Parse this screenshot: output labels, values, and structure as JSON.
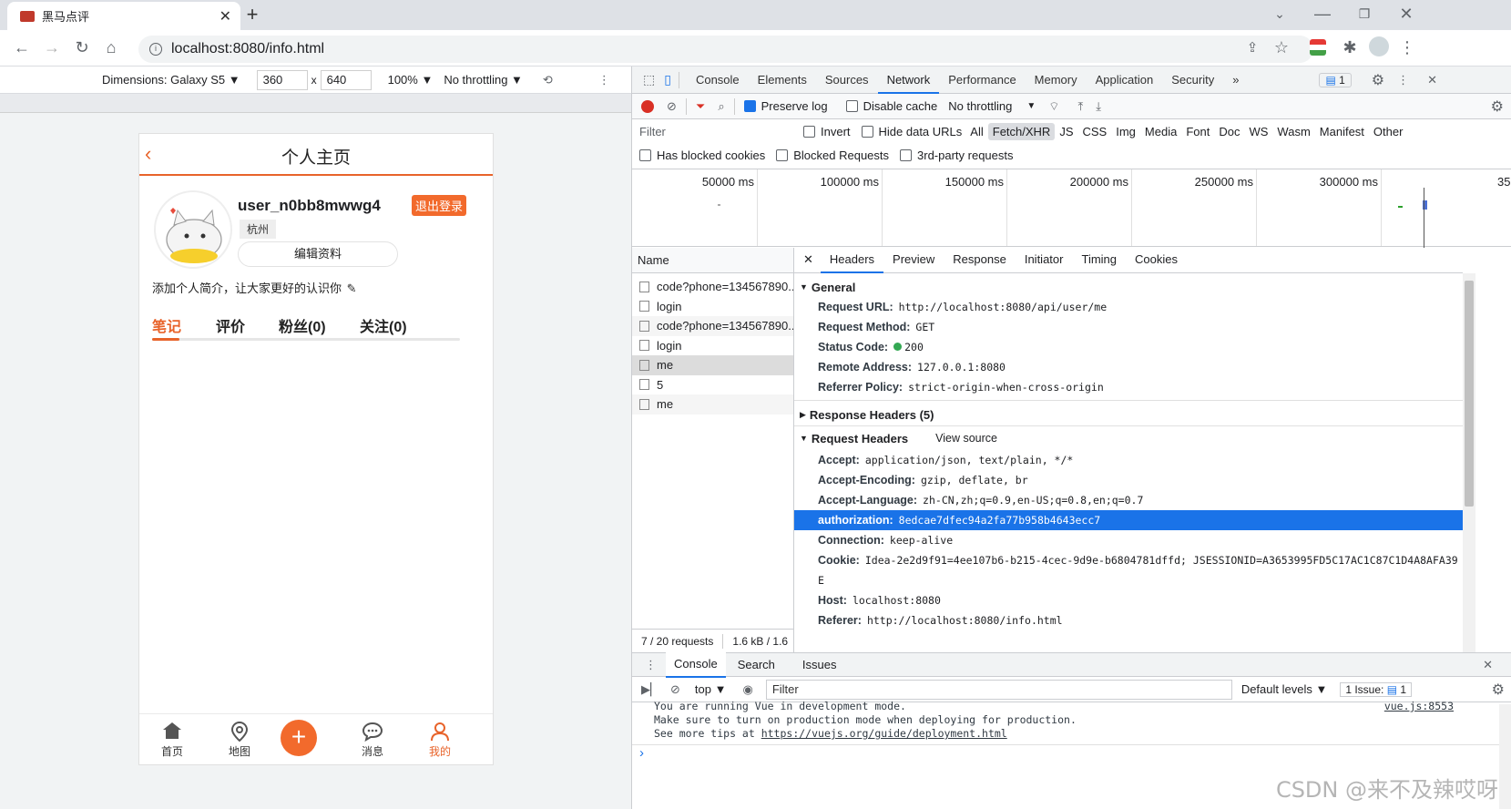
{
  "browser": {
    "tab_title": "黑马点评",
    "url": "localhost:8080/info.html"
  },
  "device_toolbar": {
    "dimensions_label": "Dimensions: Galaxy S5 ▼",
    "width": "360",
    "times": "x",
    "height": "640",
    "zoom": "100% ▼",
    "throttle": "No throttling ▼"
  },
  "page": {
    "title": "个人主页",
    "back_icon": "chevron-left-icon",
    "nickname": "user_n0bb8mwwg4",
    "logout": "退出登录",
    "city": "杭州",
    "edit_profile": "编辑资料",
    "intro": "添加个人简介，让大家更好的认识你",
    "tabs": [
      "笔记",
      "评价",
      "粉丝(0)",
      "关注(0)"
    ],
    "accent_color": "#f26a2c",
    "bottom_nav": [
      {
        "label": "首页",
        "icon": "home-icon"
      },
      {
        "label": "地图",
        "icon": "map-pin-icon"
      },
      {
        "label": "",
        "icon": "plus-icon"
      },
      {
        "label": "消息",
        "icon": "message-icon"
      },
      {
        "label": "我的",
        "icon": "user-icon"
      }
    ]
  },
  "devtools": {
    "main_tabs": [
      "Console",
      "Elements",
      "Sources",
      "Network",
      "Performance",
      "Memory",
      "Application",
      "Security",
      "»"
    ],
    "active_tab": "Network",
    "issues_badge": "1",
    "preserve_log": "Preserve log",
    "disable_cache": "Disable cache",
    "throttling": "No throttling",
    "filter_placeholder": "Filter",
    "invert": "Invert",
    "hide_data_urls": "Hide data URLs",
    "type_filters": [
      "All",
      "Fetch/XHR",
      "JS",
      "CSS",
      "Img",
      "Media",
      "Font",
      "Doc",
      "WS",
      "Wasm",
      "Manifest",
      "Other"
    ],
    "selected_type": "Fetch/XHR",
    "blocked_cookies": "Has blocked cookies",
    "blocked_requests": "Blocked Requests",
    "third_party": "3rd-party requests",
    "timeline_labels": [
      "50000 ms",
      "100000 ms",
      "150000 ms",
      "200000 ms",
      "250000 ms",
      "300000 ms",
      "35"
    ],
    "name_header": "Name",
    "requests": [
      "code?phone=134567890...",
      "login",
      "code?phone=134567890...",
      "login",
      "me",
      "5",
      "me"
    ],
    "footer_requests": "7 / 20 requests",
    "footer_size": "1.6 kB / 1.6",
    "detail_tabs": [
      "Headers",
      "Preview",
      "Response",
      "Initiator",
      "Timing",
      "Cookies"
    ],
    "general_title": "General",
    "general": [
      {
        "k": "Request URL:",
        "v": "http://localhost:8080/api/user/me"
      },
      {
        "k": "Request Method:",
        "v": "GET"
      },
      {
        "k": "Status Code:",
        "v": "200"
      },
      {
        "k": "Remote Address:",
        "v": "127.0.0.1:8080"
      },
      {
        "k": "Referrer Policy:",
        "v": "strict-origin-when-cross-origin"
      }
    ],
    "response_headers_title": "Response Headers (5)",
    "request_headers_title": "Request Headers",
    "view_source": "View source",
    "request_headers": [
      {
        "k": "Accept:",
        "v": "application/json, text/plain, */*"
      },
      {
        "k": "Accept-Encoding:",
        "v": "gzip, deflate, br"
      },
      {
        "k": "Accept-Language:",
        "v": "zh-CN,zh;q=0.9,en-US;q=0.8,en;q=0.7"
      },
      {
        "k": "authorization:",
        "v": "8edcae7dfec94a2fa77b958b4643ecc7"
      },
      {
        "k": "Connection:",
        "v": "keep-alive"
      },
      {
        "k": "Cookie:",
        "v": "Idea-2e2d9f91=4ee107b6-b215-4cec-9d9e-b6804781dffd; JSESSIONID=A3653995FD5C17AC1C87C1D4A8AFA39"
      },
      {
        "k": "",
        "v": "E"
      },
      {
        "k": "Host:",
        "v": "localhost:8080"
      },
      {
        "k": "Referer:",
        "v": "http://localhost:8080/info.html"
      }
    ],
    "console_tabs": [
      "Console",
      "Search",
      "Issues"
    ],
    "console_context": "top ▼",
    "console_filter": "Filter",
    "default_levels": "Default levels ▼",
    "issue_count": "1 Issue:",
    "issue_badge": "1",
    "console_lines": [
      "You are running Vue in development mode.",
      "Make sure to turn on production mode when deploying for production.",
      "See more tips at "
    ],
    "console_link": "https://vuejs.org/guide/deployment.html",
    "console_source": "vue.js:8553",
    "prompt": "›"
  },
  "watermark": "CSDN @来不及辣哎呀"
}
